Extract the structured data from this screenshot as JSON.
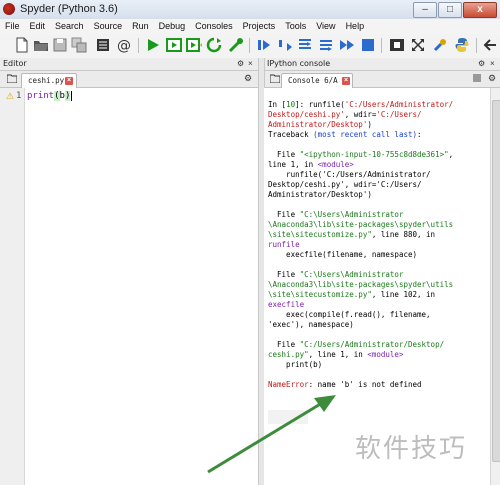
{
  "window": {
    "title": "Spyder (Python 3.6)",
    "minimize": "–",
    "maximize": "□",
    "close": "x"
  },
  "menubar": [
    "File",
    "Edit",
    "Search",
    "Source",
    "Run",
    "Debug",
    "Consoles",
    "Projects",
    "Tools",
    "View",
    "Help"
  ],
  "toolbar_icons": [
    "new-file-icon",
    "open-file-icon",
    "save-icon",
    "save-all-icon",
    "list-icon",
    "at-icon",
    "run-icon",
    "run-cell-icon",
    "run-cell-advance-icon",
    "run-selection-icon",
    "debug-icon",
    "debug-step-icon",
    "step-over-icon",
    "step-into-icon",
    "step-return-icon",
    "continue-icon",
    "stop-icon",
    "maximize-pane-icon",
    "fullscreen-icon",
    "preferences-icon",
    "python-path-icon",
    "back-icon"
  ],
  "editor": {
    "pane_title": "Editor",
    "tab_label": "ceshi.py",
    "line_number": "1",
    "code": {
      "func": "print",
      "open": "(",
      "arg": "b",
      "close": ")"
    }
  },
  "console": {
    "pane_title": "IPython console",
    "tab_label": "Console 6/A",
    "lines": [
      {
        "segments": [
          {
            "t": "In [",
            "c": ""
          },
          {
            "t": "10",
            "c": "g"
          },
          {
            "t": "]: runfile(",
            "c": ""
          },
          {
            "t": "'C:/Users/Administrator/",
            "c": "r"
          }
        ]
      },
      {
        "segments": [
          {
            "t": "Desktop/ceshi.py'",
            "c": "r"
          },
          {
            "t": ", wdir=",
            "c": ""
          },
          {
            "t": "'C:/Users/",
            "c": "r"
          }
        ]
      },
      {
        "segments": [
          {
            "t": "Administrator/Desktop'",
            "c": "r"
          },
          {
            "t": ")",
            "c": ""
          }
        ]
      },
      {
        "segments": [
          {
            "t": "Traceback ",
            "c": ""
          },
          {
            "t": "(most recent call last)",
            "c": "b"
          },
          {
            "t": ":",
            "c": ""
          }
        ]
      },
      {
        "segments": []
      },
      {
        "segments": [
          {
            "t": "  File ",
            "c": ""
          },
          {
            "t": "\"<ipython-input-10-755c8d8de361>\"",
            "c": "g"
          },
          {
            "t": ",",
            "c": ""
          }
        ]
      },
      {
        "segments": [
          {
            "t": "line 1, in ",
            "c": ""
          },
          {
            "t": "<module>",
            "c": "p"
          }
        ]
      },
      {
        "segments": [
          {
            "t": "    runfile('C:/Users/Administrator/",
            "c": ""
          }
        ]
      },
      {
        "segments": [
          {
            "t": "Desktop/ceshi.py', wdir='C:/Users/",
            "c": ""
          }
        ]
      },
      {
        "segments": [
          {
            "t": "Administrator/Desktop')",
            "c": ""
          }
        ]
      },
      {
        "segments": []
      },
      {
        "segments": [
          {
            "t": "  File ",
            "c": ""
          },
          {
            "t": "\"C:\\Users\\Administrator",
            "c": "g"
          }
        ]
      },
      {
        "segments": [
          {
            "t": "\\Anaconda3\\lib\\site-packages\\spyder\\utils",
            "c": "g"
          }
        ]
      },
      {
        "segments": [
          {
            "t": "\\site\\sitecustomize.py\"",
            "c": "g"
          },
          {
            "t": ", line 880, in",
            "c": ""
          }
        ]
      },
      {
        "segments": [
          {
            "t": "runfile",
            "c": "p"
          }
        ]
      },
      {
        "segments": [
          {
            "t": "    execfile(filename, namespace)",
            "c": ""
          }
        ]
      },
      {
        "segments": []
      },
      {
        "segments": [
          {
            "t": "  File ",
            "c": ""
          },
          {
            "t": "\"C:\\Users\\Administrator",
            "c": "g"
          }
        ]
      },
      {
        "segments": [
          {
            "t": "\\Anaconda3\\lib\\site-packages\\spyder\\utils",
            "c": "g"
          }
        ]
      },
      {
        "segments": [
          {
            "t": "\\site\\sitecustomize.py\"",
            "c": "g"
          },
          {
            "t": ", line 102, in",
            "c": ""
          }
        ]
      },
      {
        "segments": [
          {
            "t": "execfile",
            "c": "p"
          }
        ]
      },
      {
        "segments": [
          {
            "t": "    exec(compile(f.read(), filename,",
            "c": ""
          }
        ]
      },
      {
        "segments": [
          {
            "t": "'exec'), namespace)",
            "c": ""
          }
        ]
      },
      {
        "segments": []
      },
      {
        "segments": [
          {
            "t": "  File ",
            "c": ""
          },
          {
            "t": "\"C:/Users/Administrator/Desktop/",
            "c": "g"
          }
        ]
      },
      {
        "segments": [
          {
            "t": "ceshi.py\"",
            "c": "g"
          },
          {
            "t": ", line 1, in ",
            "c": ""
          },
          {
            "t": "<module>",
            "c": "p"
          }
        ]
      },
      {
        "segments": [
          {
            "t": "    print(b)",
            "c": ""
          }
        ]
      },
      {
        "segments": []
      },
      {
        "segments": [
          {
            "t": "NameError",
            "c": "r"
          },
          {
            "t": ": name 'b' is not defined",
            "c": ""
          }
        ]
      }
    ]
  },
  "watermark": "软件技巧",
  "colors": {
    "run_green": "#1a9a1a",
    "debug_blue": "#2a6bd0",
    "error_red": "#c01818",
    "arrow_green": "#3c8c3c"
  }
}
